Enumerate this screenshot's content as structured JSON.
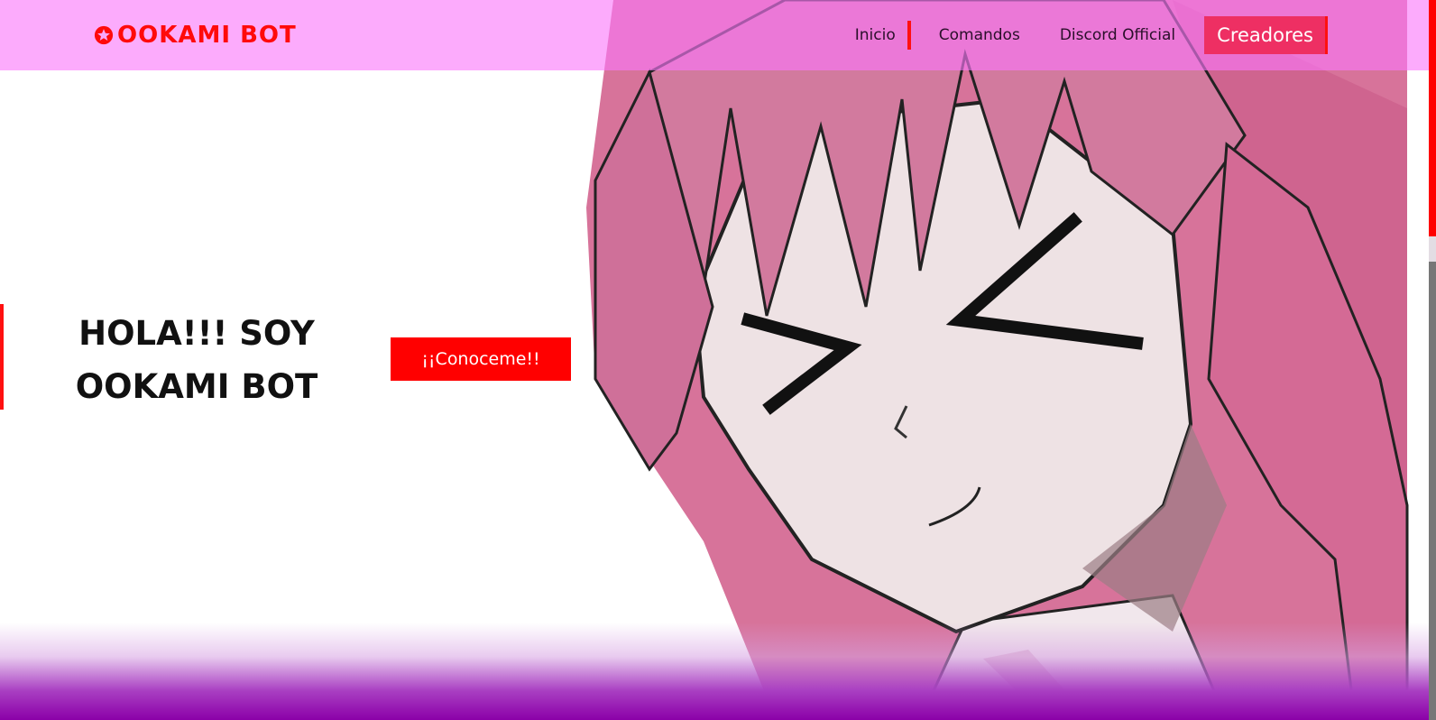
{
  "header": {
    "logo_text": "OOKAMI BOT",
    "logo_icon": "star-circle-icon",
    "nav": [
      {
        "label": "Inicio"
      },
      {
        "label": "Comandos"
      },
      {
        "label": "Discord Official"
      },
      {
        "label": "Creadores"
      }
    ]
  },
  "hero": {
    "title": "HOLA!!! SOY OOKAMI BOT",
    "cta_label": "¡¡Conoceme!!",
    "illustration": "anime-girl-pink-hair"
  },
  "colors": {
    "accent_red": "#ff0000",
    "header_pink": "#f9a6fb",
    "cta_pink": "#ee2f63",
    "bottom_purple": "#8b00a8"
  }
}
